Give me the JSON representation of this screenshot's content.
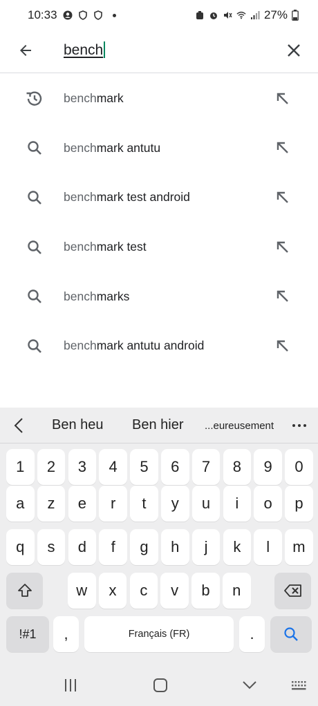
{
  "status_bar": {
    "time": "10:33",
    "battery": "27%"
  },
  "search": {
    "query": "bench"
  },
  "suggestions": [
    {
      "typed": "bench",
      "rest": "mark",
      "icon": "history-icon"
    },
    {
      "typed": "bench",
      "rest": "mark antutu",
      "icon": "search-icon"
    },
    {
      "typed": "bench",
      "rest": "mark test android",
      "icon": "search-icon"
    },
    {
      "typed": "bench",
      "rest": "mark test",
      "icon": "search-icon"
    },
    {
      "typed": "bench",
      "rest": "marks",
      "icon": "search-icon"
    },
    {
      "typed": "bench",
      "rest": "mark antutu android",
      "icon": "search-icon"
    }
  ],
  "keyboard": {
    "predictions": [
      "Ben heu",
      "Ben hier",
      "...eureusement"
    ],
    "number_row": [
      "1",
      "2",
      "3",
      "4",
      "5",
      "6",
      "7",
      "8",
      "9",
      "0"
    ],
    "row1": [
      "a",
      "z",
      "e",
      "r",
      "t",
      "y",
      "u",
      "i",
      "o",
      "p"
    ],
    "row2": [
      "q",
      "s",
      "d",
      "f",
      "g",
      "h",
      "j",
      "k",
      "l",
      "m"
    ],
    "row3": [
      "w",
      "x",
      "c",
      "v",
      "b",
      "n"
    ],
    "symbols_label": "!#1",
    "comma_label": ",",
    "space_label": "Français (FR)",
    "period_label": ".",
    "accent_color": "#1a73e8"
  }
}
